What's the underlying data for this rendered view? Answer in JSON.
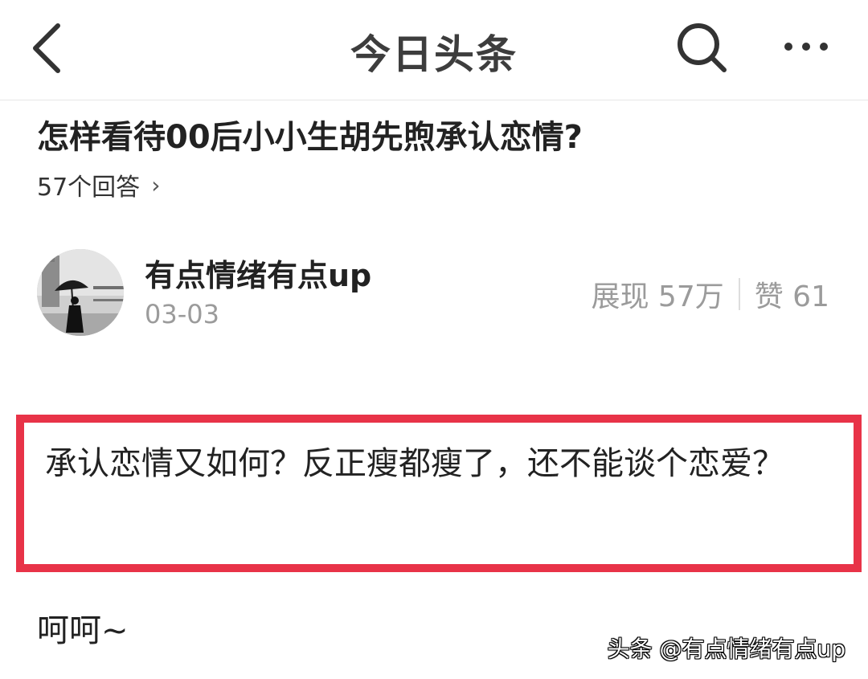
{
  "nav": {
    "title": "今日头条",
    "back_icon": "back-arrow-icon",
    "search_icon": "search-icon",
    "more_icon": "more-dots-icon"
  },
  "question": {
    "title": "怎样看待00后小小生胡先煦承认恋情?",
    "answers_label": "57个回答",
    "chevron": "›"
  },
  "author": {
    "name": "有点情绪有点up",
    "date": "03-03",
    "views_label": "展现 57万",
    "likes_label": "赞 61"
  },
  "answer": {
    "highlight": "承认恋情又如何？反正瘦都瘦了，还不能谈个恋爱？",
    "body": "呵呵~"
  },
  "watermark": "头条 @有点情绪有点up",
  "colors": {
    "highlight_border": "#e83348",
    "muted_text": "#9b9b9b"
  }
}
